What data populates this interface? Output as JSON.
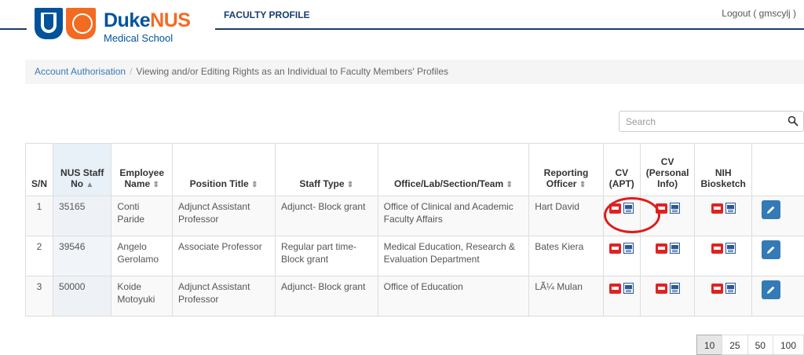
{
  "header": {
    "logo_name_duke": "Duke",
    "logo_name_nus": "NUS",
    "logo_subtitle": "Medical School",
    "app_title": "FACULTY PROFILE",
    "logout_label": "Logout ( gmscylj )"
  },
  "breadcrumb": {
    "link": "Account Authorisation",
    "separator": "/",
    "current": "Viewing and/or Editing Rights as an Individual to Faculty Members' Profiles"
  },
  "search": {
    "placeholder": "Search"
  },
  "table": {
    "headers": {
      "sn": "S/N",
      "staff_no": "NUS Staff No",
      "employee_name": "Employee Name",
      "position_title": "Position Title",
      "staff_type": "Staff Type",
      "office": "Office/Lab/Section/Team",
      "reporting_officer": "Reporting Officer",
      "cv_apt": "CV (APT)",
      "cv_personal": "CV (Personal Info)",
      "nih": "NIH Biosketch"
    },
    "sort_asc_glyph": "▲",
    "sort_both_glyph": "⇕",
    "rows": [
      {
        "sn": "1",
        "staff_no": "35165",
        "employee_name": "Conti Paride",
        "position_title": "Adjunct Assistant Professor",
        "staff_type": "Adjunct- Block grant",
        "office": "Office of Clinical and Academic Faculty Affairs",
        "reporting_officer": "Hart David"
      },
      {
        "sn": "2",
        "staff_no": "39546",
        "employee_name": "Angelo Gerolamo",
        "position_title": "Associate Professor",
        "staff_type": "Regular part time- Block grant",
        "office": "Medical Education, Research & Evaluation Department",
        "reporting_officer": "Bates Kiera"
      },
      {
        "sn": "3",
        "staff_no": "50000",
        "employee_name": "Koide Motoyuki",
        "position_title": "Adjunct Assistant Professor",
        "staff_type": "Adjunct- Block grant",
        "office": "Office of Education",
        "reporting_officer": "LÃ¼ Mulan"
      }
    ]
  },
  "pagination": {
    "page_sizes": [
      "10",
      "25",
      "50",
      "100"
    ],
    "active": "10"
  },
  "icons": {
    "pdf": "pdf-icon",
    "word": "word-doc-icon",
    "edit": "pencil-icon",
    "search": "search-icon"
  },
  "colors": {
    "brand_blue": "#00539b",
    "brand_orange": "#f26b21",
    "link": "#337ab7",
    "highlight": "#e01b1b"
  }
}
